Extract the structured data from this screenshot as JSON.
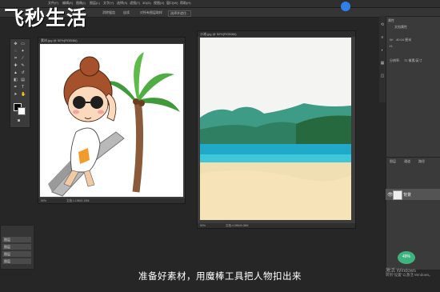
{
  "watermark": {
    "logo": "飞秒生活"
  },
  "menubar": {
    "items": [
      "文件(F)",
      "编辑(E)",
      "图像(I)",
      "图层(L)",
      "文字(Y)",
      "选择(S)",
      "滤镜(T)",
      "3D(D)",
      "视图(V)",
      "窗口(W)",
      "帮助(H)"
    ]
  },
  "options": {
    "items": [
      "消除锯齿",
      "连续",
      "对所有图层取样",
      "选择并遮住..."
    ]
  },
  "doc_a": {
    "tab": "素材.jpg @ 50%(RGB/8#)",
    "zoom": "50%",
    "info": "文档:1.15M/1.15M"
  },
  "doc_b": {
    "tab": "沙滩.jpg @ 50%(RGB/8#)",
    "zoom": "50%",
    "info": "文档:4.08M/4.08M"
  },
  "properties": {
    "title": "属性",
    "doc_label": "文档属性",
    "w_label": "W:",
    "w_value": "40.04 厘米",
    "h_label": "H:",
    "h_value": "",
    "res_label": "分辨率:",
    "res_value": "72 像素/英寸"
  },
  "layers": {
    "tabs": [
      "图层",
      "通道",
      "路径"
    ],
    "layer_name": "背景"
  },
  "history": {
    "items": [
      "图层",
      "图层",
      "图层",
      "图层"
    ]
  },
  "subtitle": "准备好素材，用魔棒工具把人物扣出来",
  "activate": {
    "line1": "激活 Windows",
    "line2": "转到\"设置\"以激活 Windows。"
  },
  "speed": {
    "label": "49%"
  },
  "colors": {
    "foreground": "#000000",
    "background": "#ffffff",
    "accent": "#2f80ed"
  }
}
